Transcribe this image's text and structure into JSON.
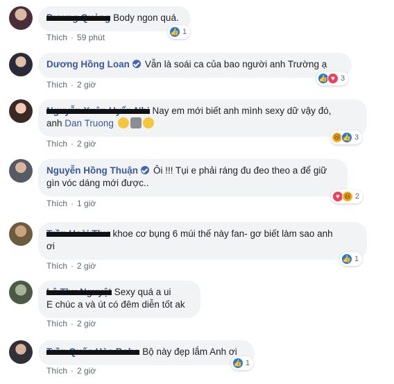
{
  "comments": [
    {
      "name": "Dương Quảng",
      "redacted": true,
      "verified": false,
      "text": "Body ngon quá.",
      "reply": "Thích",
      "time": "59 phút",
      "reactions": [
        "like"
      ],
      "reaction_count": "1"
    },
    {
      "name": "Dương Hồng Loan",
      "redacted": false,
      "verified": true,
      "text": "Vẫn là soái ca của bao người anh Trường ạ",
      "reply": "Thích",
      "time": "2 giờ",
      "reactions": [
        "like",
        "love"
      ],
      "reaction_count": "3"
    },
    {
      "name": "Nguyễn Xuân Uyển Nhi",
      "redacted": true,
      "verified": false,
      "text_line1": "Nay em mới biết anh mình sexy dữ vậy đó,",
      "text_line2_prefix": "anh",
      "tag": "Dan Truong",
      "reply": "Thích",
      "time": "2 giờ",
      "reactions": [
        "haha",
        "like"
      ],
      "reaction_count": "3"
    },
    {
      "name": "Nguyễn Hồng Thuận",
      "redacted": false,
      "verified": true,
      "text_line1": "Ôi !!! Tụi e phải ráng đu đeo theo a để giữ",
      "text_line2": "gìn vóc dáng mới được..",
      "reply": "Thích",
      "time": "1 giờ",
      "reactions": [
        "love",
        "haha"
      ],
      "reaction_count": "2"
    },
    {
      "name": "Trần Hoài Thư",
      "redacted": true,
      "verified": false,
      "text_line1": "khoe cơ bụng 6 múi thế này fan- gơ biết làm sao anh",
      "text_line2": "ơi",
      "reply": "Thích",
      "time": "2 giờ",
      "reactions": [
        "like"
      ],
      "reaction_count": "1"
    },
    {
      "name": "Lê Thu Nguyệt",
      "redacted": true,
      "verified": false,
      "text_line1": "Sexy quá a ui",
      "text_line2": "E chúc a và út có đêm diễn tốt ak",
      "reply": "Thích",
      "time": "2 giờ"
    },
    {
      "name": "Trần Quốc Hòa Bobo",
      "redacted": true,
      "verified": false,
      "text": "Bộ này đẹp lắm Anh ơi",
      "reply": "Thích",
      "time": "2 giờ",
      "reactions": [
        "like"
      ],
      "reaction_count": "1"
    }
  ],
  "colors": {
    "name": "#385898",
    "bubble": "#f2f3f5",
    "meta": "#606770",
    "like": "#1877f2",
    "love": "#f33e58",
    "haha": "#f7b125"
  }
}
